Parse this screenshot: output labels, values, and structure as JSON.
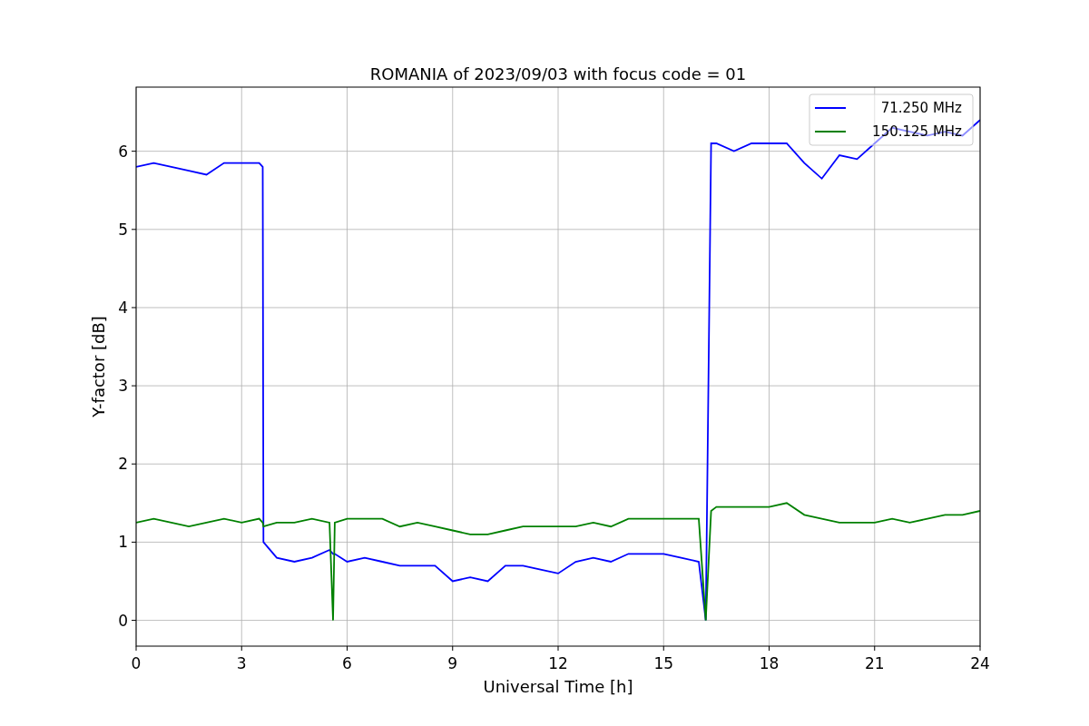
{
  "figure": {
    "chart_data": {
      "type": "line",
      "grid": true,
      "title": "ROMANIA of 2023/09/03 with focus code = 01",
      "xlabel": "Universal Time [h]",
      "ylabel": "Y-factor [dB]",
      "xlim": [
        0,
        24
      ],
      "ylim": [
        -0.33,
        6.82
      ],
      "xticks": [
        0,
        3,
        6,
        9,
        12,
        15,
        18,
        21,
        24
      ],
      "yticks": [
        0,
        1,
        2,
        3,
        4,
        5,
        6
      ],
      "x": [
        0,
        0.5,
        1,
        1.5,
        2,
        2.5,
        3,
        3.5,
        3.6,
        3.62,
        4,
        4.5,
        5,
        5.5,
        5.6,
        5.65,
        6,
        6.5,
        7,
        7.5,
        8,
        8.5,
        9,
        9.5,
        10,
        10.5,
        11,
        11.5,
        12,
        12.5,
        13,
        13.5,
        14,
        14.5,
        15,
        15.5,
        16,
        16.2,
        16.35,
        16.5,
        17,
        17.5,
        18,
        18.5,
        19,
        19.5,
        20,
        20.5,
        21,
        21.5,
        22,
        22.5,
        23,
        23.5,
        24
      ],
      "series": [
        {
          "name": "71.250 MHz",
          "color": "#0000ff",
          "values": [
            5.8,
            5.85,
            5.8,
            5.75,
            5.7,
            5.85,
            5.85,
            5.85,
            5.8,
            1.0,
            0.8,
            0.75,
            0.8,
            0.9,
            0.85,
            0.85,
            0.75,
            0.8,
            0.75,
            0.7,
            0.7,
            0.7,
            0.5,
            0.55,
            0.5,
            0.7,
            0.7,
            0.65,
            0.6,
            0.75,
            0.8,
            0.75,
            0.85,
            0.85,
            0.85,
            0.8,
            0.75,
            0.0,
            6.1,
            6.1,
            6.0,
            6.1,
            6.1,
            6.1,
            5.85,
            5.65,
            5.95,
            5.9,
            6.1,
            6.3,
            6.25,
            6.2,
            6.25,
            6.2,
            6.4
          ]
        },
        {
          "name": "150.125 MHz",
          "color": "#008000",
          "values": [
            1.25,
            1.3,
            1.25,
            1.2,
            1.25,
            1.3,
            1.25,
            1.3,
            1.25,
            1.2,
            1.25,
            1.25,
            1.3,
            1.25,
            0.0,
            1.25,
            1.3,
            1.3,
            1.3,
            1.2,
            1.25,
            1.2,
            1.15,
            1.1,
            1.1,
            1.15,
            1.2,
            1.2,
            1.2,
            1.2,
            1.25,
            1.2,
            1.3,
            1.3,
            1.3,
            1.3,
            1.3,
            0.0,
            1.4,
            1.45,
            1.45,
            1.45,
            1.45,
            1.5,
            1.35,
            1.3,
            1.25,
            1.25,
            1.25,
            1.3,
            1.25,
            1.3,
            1.35,
            1.35,
            1.4
          ]
        }
      ]
    }
  }
}
